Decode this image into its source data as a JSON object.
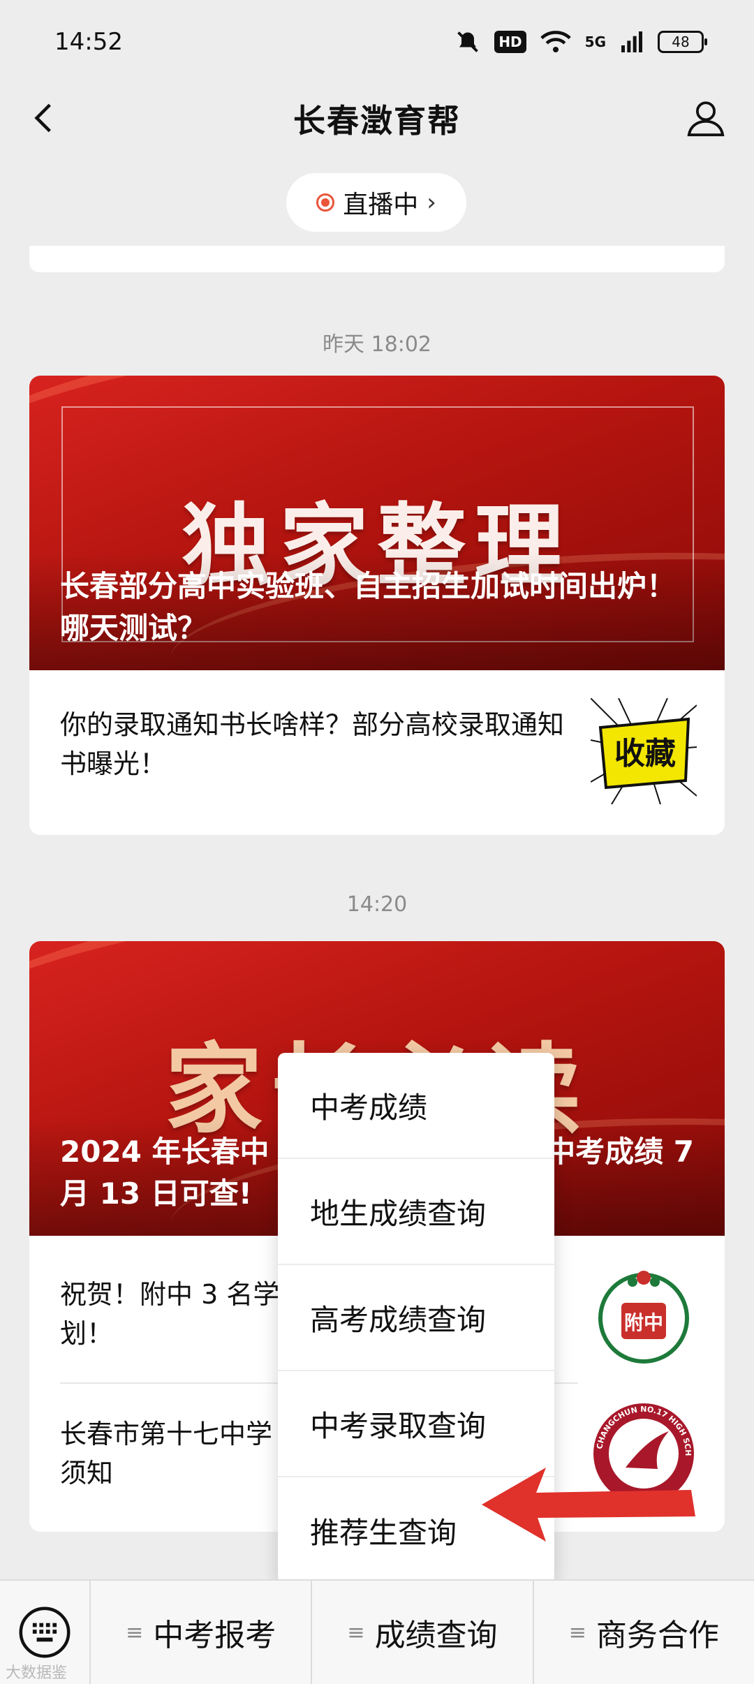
{
  "status_bar": {
    "time": "14:52",
    "hd": "HD",
    "network": "5G",
    "battery": "48"
  },
  "nav": {
    "title": "长春澂育帮"
  },
  "live": {
    "label": "直播中",
    "chevron": "›"
  },
  "feed": [
    {
      "timestamp": "昨天 18:02",
      "banner_big": "独家整理",
      "headline": "长春部分高中实验班、自主招生加试时间出炉！哪天测试？",
      "items": [
        {
          "title": "你的录取通知书长啥样？部分高校录取通知书曝光！",
          "thumb_text": "收藏"
        }
      ]
    },
    {
      "timestamp": "14:20",
      "banner_big": "家长必读",
      "headline_left": "2024 年长春中",
      "headline_right": "中考成绩 7",
      "headline_line2": "月 13 日可查!",
      "items": [
        {
          "title_left": "祝贺！附中 3 名学",
          "title_line2": "划！",
          "thumb_text": "附中"
        },
        {
          "title_left": "长春市第十七中学",
          "title_line2": "须知",
          "thumb_text": "CHANGCHUN NO.17 HIGH SCHOOL"
        }
      ]
    }
  ],
  "menu": {
    "items": [
      "中考成绩",
      "地生成绩查询",
      "高考成绩查询",
      "中考录取查询",
      "推荐生查询"
    ]
  },
  "bottom_bar": {
    "tabs": [
      "中考报考",
      "成绩查询",
      "商务合作"
    ]
  },
  "watermark": "大数据鉴",
  "colors": {
    "accent_red": "#e9543a",
    "banner_red": "#c41a15",
    "arrow_red": "#e0312b"
  }
}
